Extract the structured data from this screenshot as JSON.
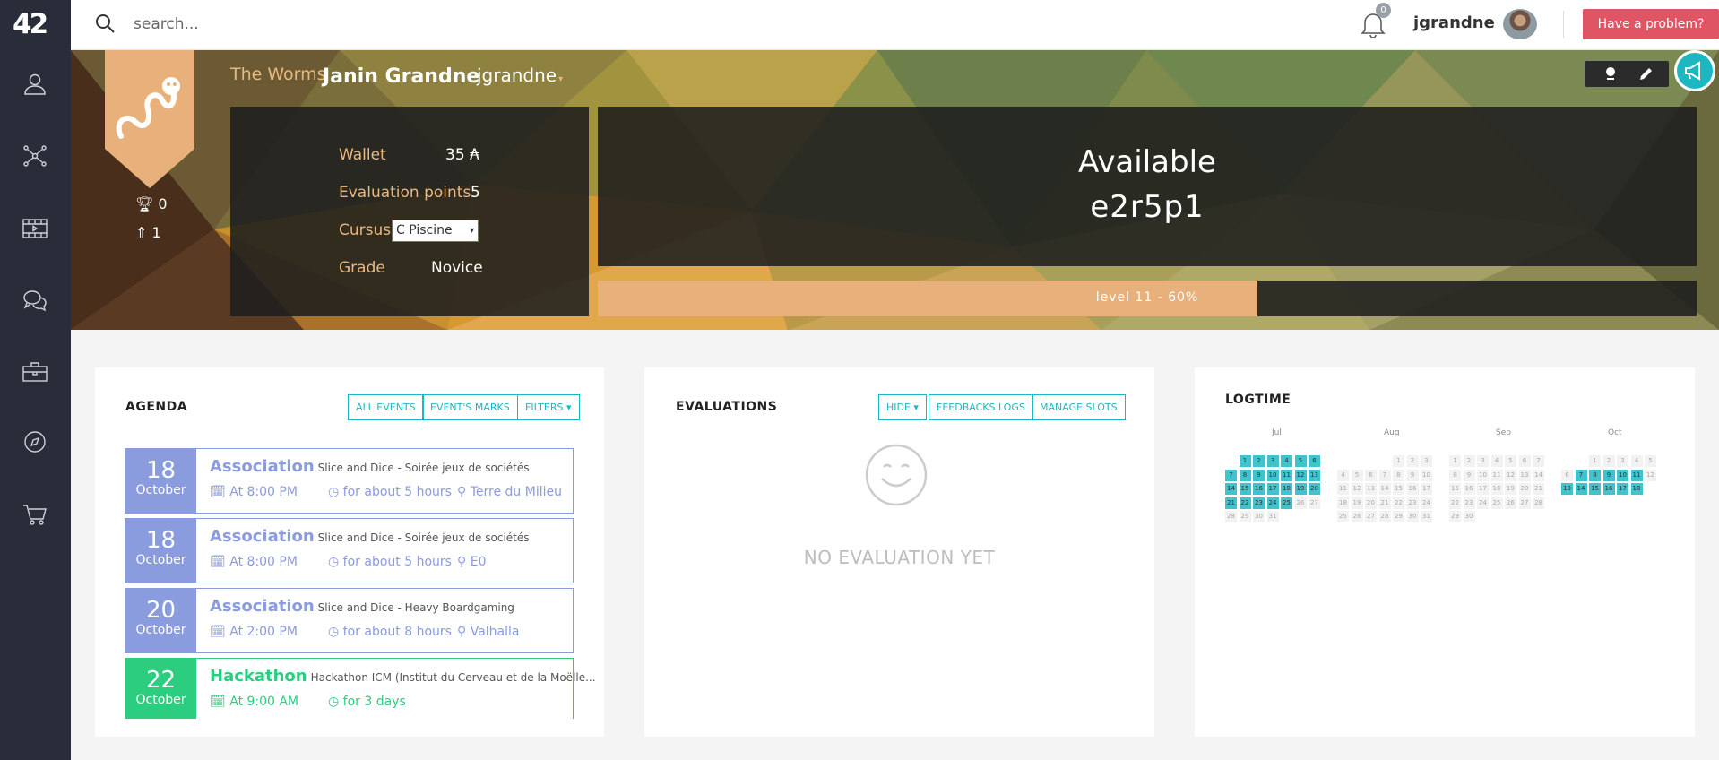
{
  "app": {
    "logo": "42"
  },
  "sidebar": {
    "items": [
      {
        "icon": "user-icon"
      },
      {
        "icon": "graph-icon"
      },
      {
        "icon": "film-icon"
      },
      {
        "icon": "chat-icon"
      },
      {
        "icon": "briefcase-icon"
      },
      {
        "icon": "compass-icon"
      },
      {
        "icon": "cart-icon"
      }
    ]
  },
  "topbar": {
    "search_placeholder": "search...",
    "notification_count": "0",
    "username": "jgrandne",
    "problem_button": "Have a problem?"
  },
  "profile": {
    "coalition": "The Worms",
    "full_name": "Janin Grandne",
    "login": "jgrandne",
    "trophies": "0",
    "achievements": "1",
    "wallet_label": "Wallet",
    "wallet_value": "35 ₳",
    "eval_label": "Evaluation points",
    "eval_value": "5",
    "cursus_label": "Cursus",
    "cursus_value": "C Piscine",
    "grade_label": "Grade",
    "grade_value": "Novice",
    "availability": "Available",
    "host": "e2r5p1",
    "level_text": "level 11 - 60%",
    "level_progress": 0.6,
    "colors": {
      "accent": "#e8b87e",
      "teal": "#1db7c2",
      "danger": "#e05564"
    }
  },
  "agenda": {
    "title": "AGENDA",
    "buttons": [
      "ALL EVENTS",
      "EVENT'S MARKS",
      "FILTERS ▾"
    ],
    "events": [
      {
        "day": "18",
        "month": "October",
        "kind": "Association",
        "name": "Slice and Dice - Soirée jeux de sociétés",
        "time": "At 8:00 PM",
        "duration": "for about 5 hours",
        "location": "Terre du Milieu"
      },
      {
        "day": "18",
        "month": "October",
        "kind": "Association",
        "name": "Slice and Dice - Soirée jeux de sociétés",
        "time": "At 8:00 PM",
        "duration": "for about 5 hours",
        "location": "E0"
      },
      {
        "day": "20",
        "month": "October",
        "kind": "Association",
        "name": "Slice and Dice - Heavy Boardgaming",
        "time": "At 2:00 PM",
        "duration": "for about 8 hours",
        "location": "Valhalla"
      },
      {
        "day": "22",
        "month": "October",
        "kind": "Hackathon",
        "name": "Hackathon ICM (Institut du Cerveau et de la Moëlle...",
        "time": "At 9:00 AM",
        "duration": "for 3 days",
        "location": ""
      }
    ]
  },
  "evaluations": {
    "title": "EVALUATIONS",
    "buttons": [
      "HIDE ▾",
      "FEEDBACKS LOGS",
      "MANAGE SLOTS"
    ],
    "empty_text": "NO EVALUATION YET"
  },
  "logtime": {
    "title": "LOGTIME",
    "months": [
      {
        "name": "Jul",
        "first_weekday": 1,
        "days": 31,
        "active": [
          1,
          2,
          3,
          4,
          5,
          6,
          7,
          8,
          9,
          10,
          11,
          12,
          13,
          14,
          15,
          16,
          17,
          18,
          19,
          20,
          21,
          22,
          23,
          24,
          25
        ]
      },
      {
        "name": "Aug",
        "first_weekday": 4,
        "days": 31,
        "active": []
      },
      {
        "name": "Sep",
        "first_weekday": 0,
        "days": 30,
        "active": []
      },
      {
        "name": "Oct",
        "first_weekday": 2,
        "days": 18,
        "active": [
          7,
          8,
          9,
          10,
          11,
          13,
          14,
          15,
          16,
          17,
          18
        ]
      }
    ]
  }
}
